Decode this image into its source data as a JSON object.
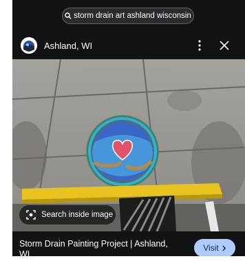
{
  "search": {
    "query": "storm drain art ashland wisconsin",
    "icon": "search-icon"
  },
  "header": {
    "site_name": "Ashland, WI",
    "menu_icon": "more-vert-icon",
    "close_icon": "close-icon"
  },
  "lens": {
    "label": "Search inside image",
    "icon": "lens-icon"
  },
  "result": {
    "title_line1": "Storm Drain Painting Project | Ashland,",
    "title_line2": "WI",
    "visit_label": "Visit",
    "visit_icon": "chevron-right-icon"
  },
  "colors": {
    "background": "#111214",
    "visit_button": "#aecbfa",
    "curb_yellow": "#e8c21e",
    "pavement": "#9a9894"
  }
}
